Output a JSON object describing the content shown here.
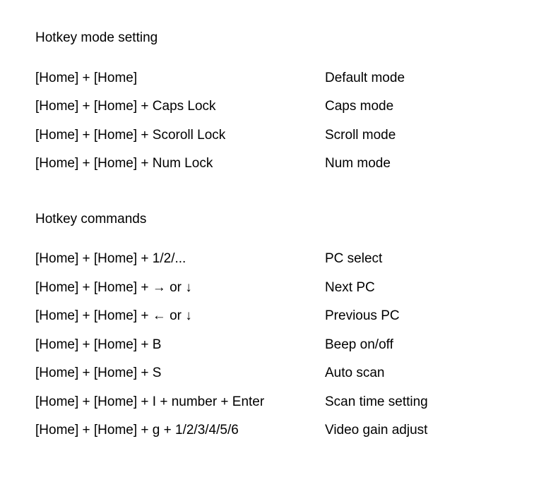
{
  "sections": [
    {
      "title": "Hotkey mode setting",
      "rows": [
        {
          "left": "[Home] + [Home]",
          "right": "Default mode"
        },
        {
          "left": "[Home] + [Home] + Caps Lock",
          "right": "Caps mode"
        },
        {
          "left": "[Home] + [Home] + Scoroll Lock",
          "right": "Scroll mode"
        },
        {
          "left": "[Home] + [Home] + Num Lock",
          "right": "Num mode"
        }
      ]
    },
    {
      "title": "Hotkey commands",
      "rows": [
        {
          "left": "[Home] + [Home] + 1/2/...",
          "right": "PC select"
        },
        {
          "left": "[Home] + [Home] + → or ↓",
          "right": "Next PC"
        },
        {
          "left": "[Home] + [Home] + ← or ↓",
          "right": "Previous PC"
        },
        {
          "left": "[Home] + [Home] + B",
          "right": "Beep on/off"
        },
        {
          "left": "[Home] + [Home] + S",
          "right": "Auto scan"
        },
        {
          "left": "[Home] + [Home] + I + number + Enter",
          "right": "Scan time setting"
        },
        {
          "left": "[Home] + [Home] + g + 1/2/3/4/5/6",
          "right": "Video gain adjust"
        }
      ]
    }
  ]
}
